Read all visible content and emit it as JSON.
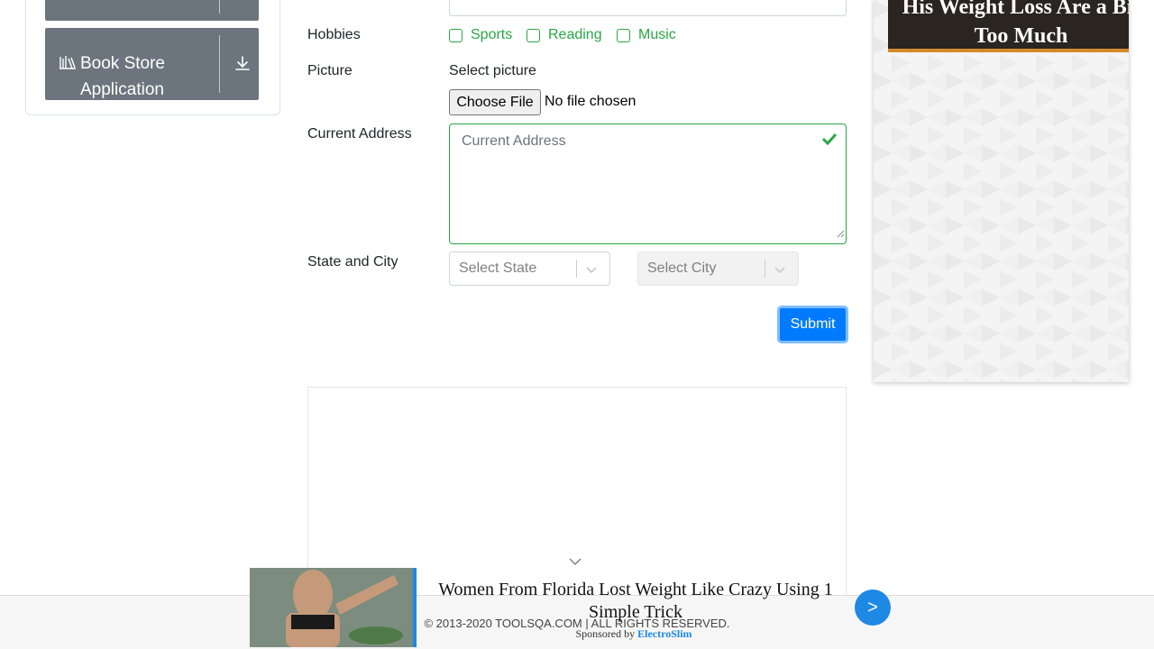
{
  "sidebar": {
    "book_store_group": {
      "label": "Book Store Application",
      "icon": "books-icon",
      "toggle_icon": "download-arrow-icon"
    }
  },
  "form": {
    "hobbies": {
      "label": "Hobbies",
      "options": [
        {
          "label": "Sports",
          "checked": false
        },
        {
          "label": "Reading",
          "checked": false
        },
        {
          "label": "Music",
          "checked": false
        }
      ]
    },
    "picture": {
      "label": "Picture",
      "select_text": "Select picture",
      "button_label": "Choose File",
      "status": "No file chosen"
    },
    "address": {
      "label": "Current Address",
      "placeholder": "Current Address",
      "valid": true
    },
    "state_city": {
      "label": "State and City",
      "state_placeholder": "Select State",
      "city_placeholder": "Select City",
      "city_disabled": true
    },
    "submit_label": "Submit"
  },
  "right_ad": {
    "headline_line1": "His Weight Loss Are a Bit",
    "headline_line2": "Too Much"
  },
  "footer": {
    "copyright": "© 2013-2020 TOOLSQA.COM | ALL RIGHTS RESERVED."
  },
  "sponsored_ad": {
    "headline": "Women From Florida Lost Weight Like Crazy Using 1 Simple Trick",
    "sponsored_prefix": "Sponsored by",
    "sponsor_name": "ElectroSlim",
    "next_label": ">"
  },
  "colors": {
    "primary": "#007bff",
    "success": "#28a745",
    "sidebar_header": "#6c757d",
    "ad_accent": "#1e88e5"
  }
}
